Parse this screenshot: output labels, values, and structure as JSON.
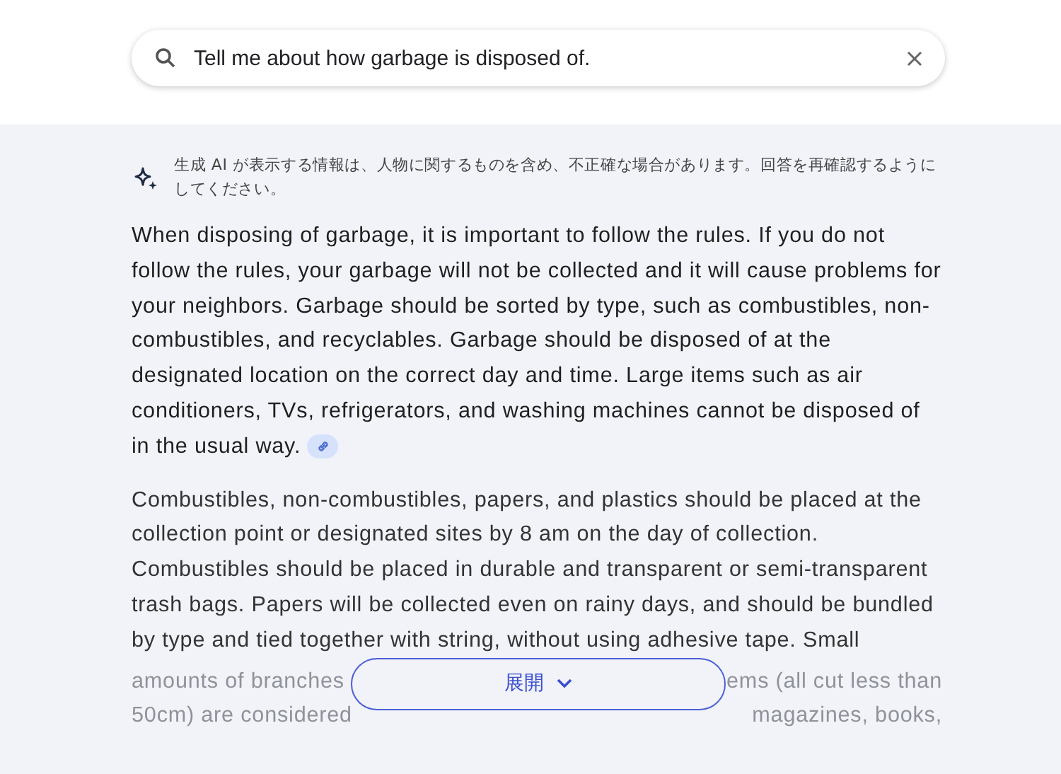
{
  "search": {
    "value": "Tell me about how garbage is disposed of."
  },
  "notice": "生成 AI が表示する情報は、人物に関するものを含め、不正確な場合があります。回答を再確認するようにしてください。",
  "paragraphs": [
    {
      "text": "When disposing of garbage, it is important to follow the rules. If you do not follow the rules, your garbage will not be collected and it will cause problems for your neighbors. Garbage should be sorted by type, such as combustibles, non-combustibles, and recyclables. Garbage should be disposed of at the designated location on the correct day and time. Large items such as air conditioners, TVs, refrigerators, and washing machines cannot be disposed of in the usual way.",
      "has_link": true
    },
    {
      "text": "Combustibles, non-combustibles, papers, and plastics should be placed at the collection point or designated sites by 8 am on the day of collection. Combustibles should be placed in durable and transparent or semi-transparent trash bags. Papers will be collected even on rainy days, and should be bundled by type and tied together with string, without using adhesive tape. Small",
      "has_link": false
    }
  ],
  "faded_lines": [
    {
      "left": "amounts of branches",
      "right": "ems (all cut less than"
    },
    {
      "left": "50cm) are considered",
      "right": "magazines, books,"
    }
  ],
  "expand_button": {
    "label": "展開"
  }
}
